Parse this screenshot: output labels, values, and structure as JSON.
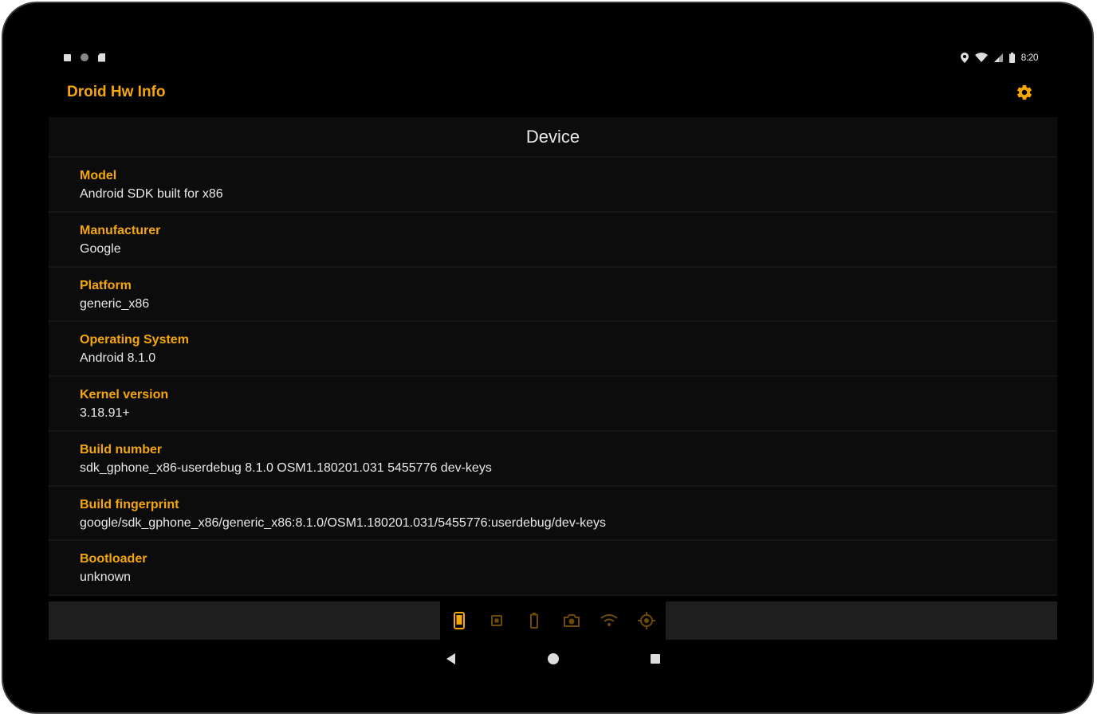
{
  "status_bar": {
    "time": "8:20",
    "left_icons": [
      "notification-square-icon",
      "circle-icon",
      "sd-card-icon"
    ],
    "right_icons": [
      "location-icon",
      "wifi-icon",
      "signal-icon",
      "battery-icon"
    ]
  },
  "app": {
    "title": "Droid Hw Info",
    "settings_icon": "gear-icon",
    "accent_color": "#f5a70a"
  },
  "section": {
    "title": "Device",
    "items": [
      {
        "label": "Model",
        "value": "Android SDK built for x86"
      },
      {
        "label": "Manufacturer",
        "value": "Google"
      },
      {
        "label": "Platform",
        "value": "generic_x86"
      },
      {
        "label": "Operating System",
        "value": "Android 8.1.0"
      },
      {
        "label": "Kernel version",
        "value": "3.18.91+"
      },
      {
        "label": "Build number",
        "value": "sdk_gphone_x86-userdebug 8.1.0 OSM1.180201.031 5455776 dev-keys"
      },
      {
        "label": "Build fingerprint",
        "value": "google/sdk_gphone_x86/generic_x86:8.1.0/OSM1.180201.031/5455776:userdebug/dev-keys"
      },
      {
        "label": "Bootloader",
        "value": "unknown"
      }
    ]
  },
  "bottom_tabs": [
    {
      "icon": "phone-icon",
      "active": true
    },
    {
      "icon": "cpu-icon",
      "active": false
    },
    {
      "icon": "battery-tab-icon",
      "active": false
    },
    {
      "icon": "camera-icon",
      "active": false
    },
    {
      "icon": "wifi-tab-icon",
      "active": false
    },
    {
      "icon": "location-tab-icon",
      "active": false
    }
  ],
  "nav_bar": [
    "back-icon",
    "home-icon",
    "recents-icon"
  ]
}
